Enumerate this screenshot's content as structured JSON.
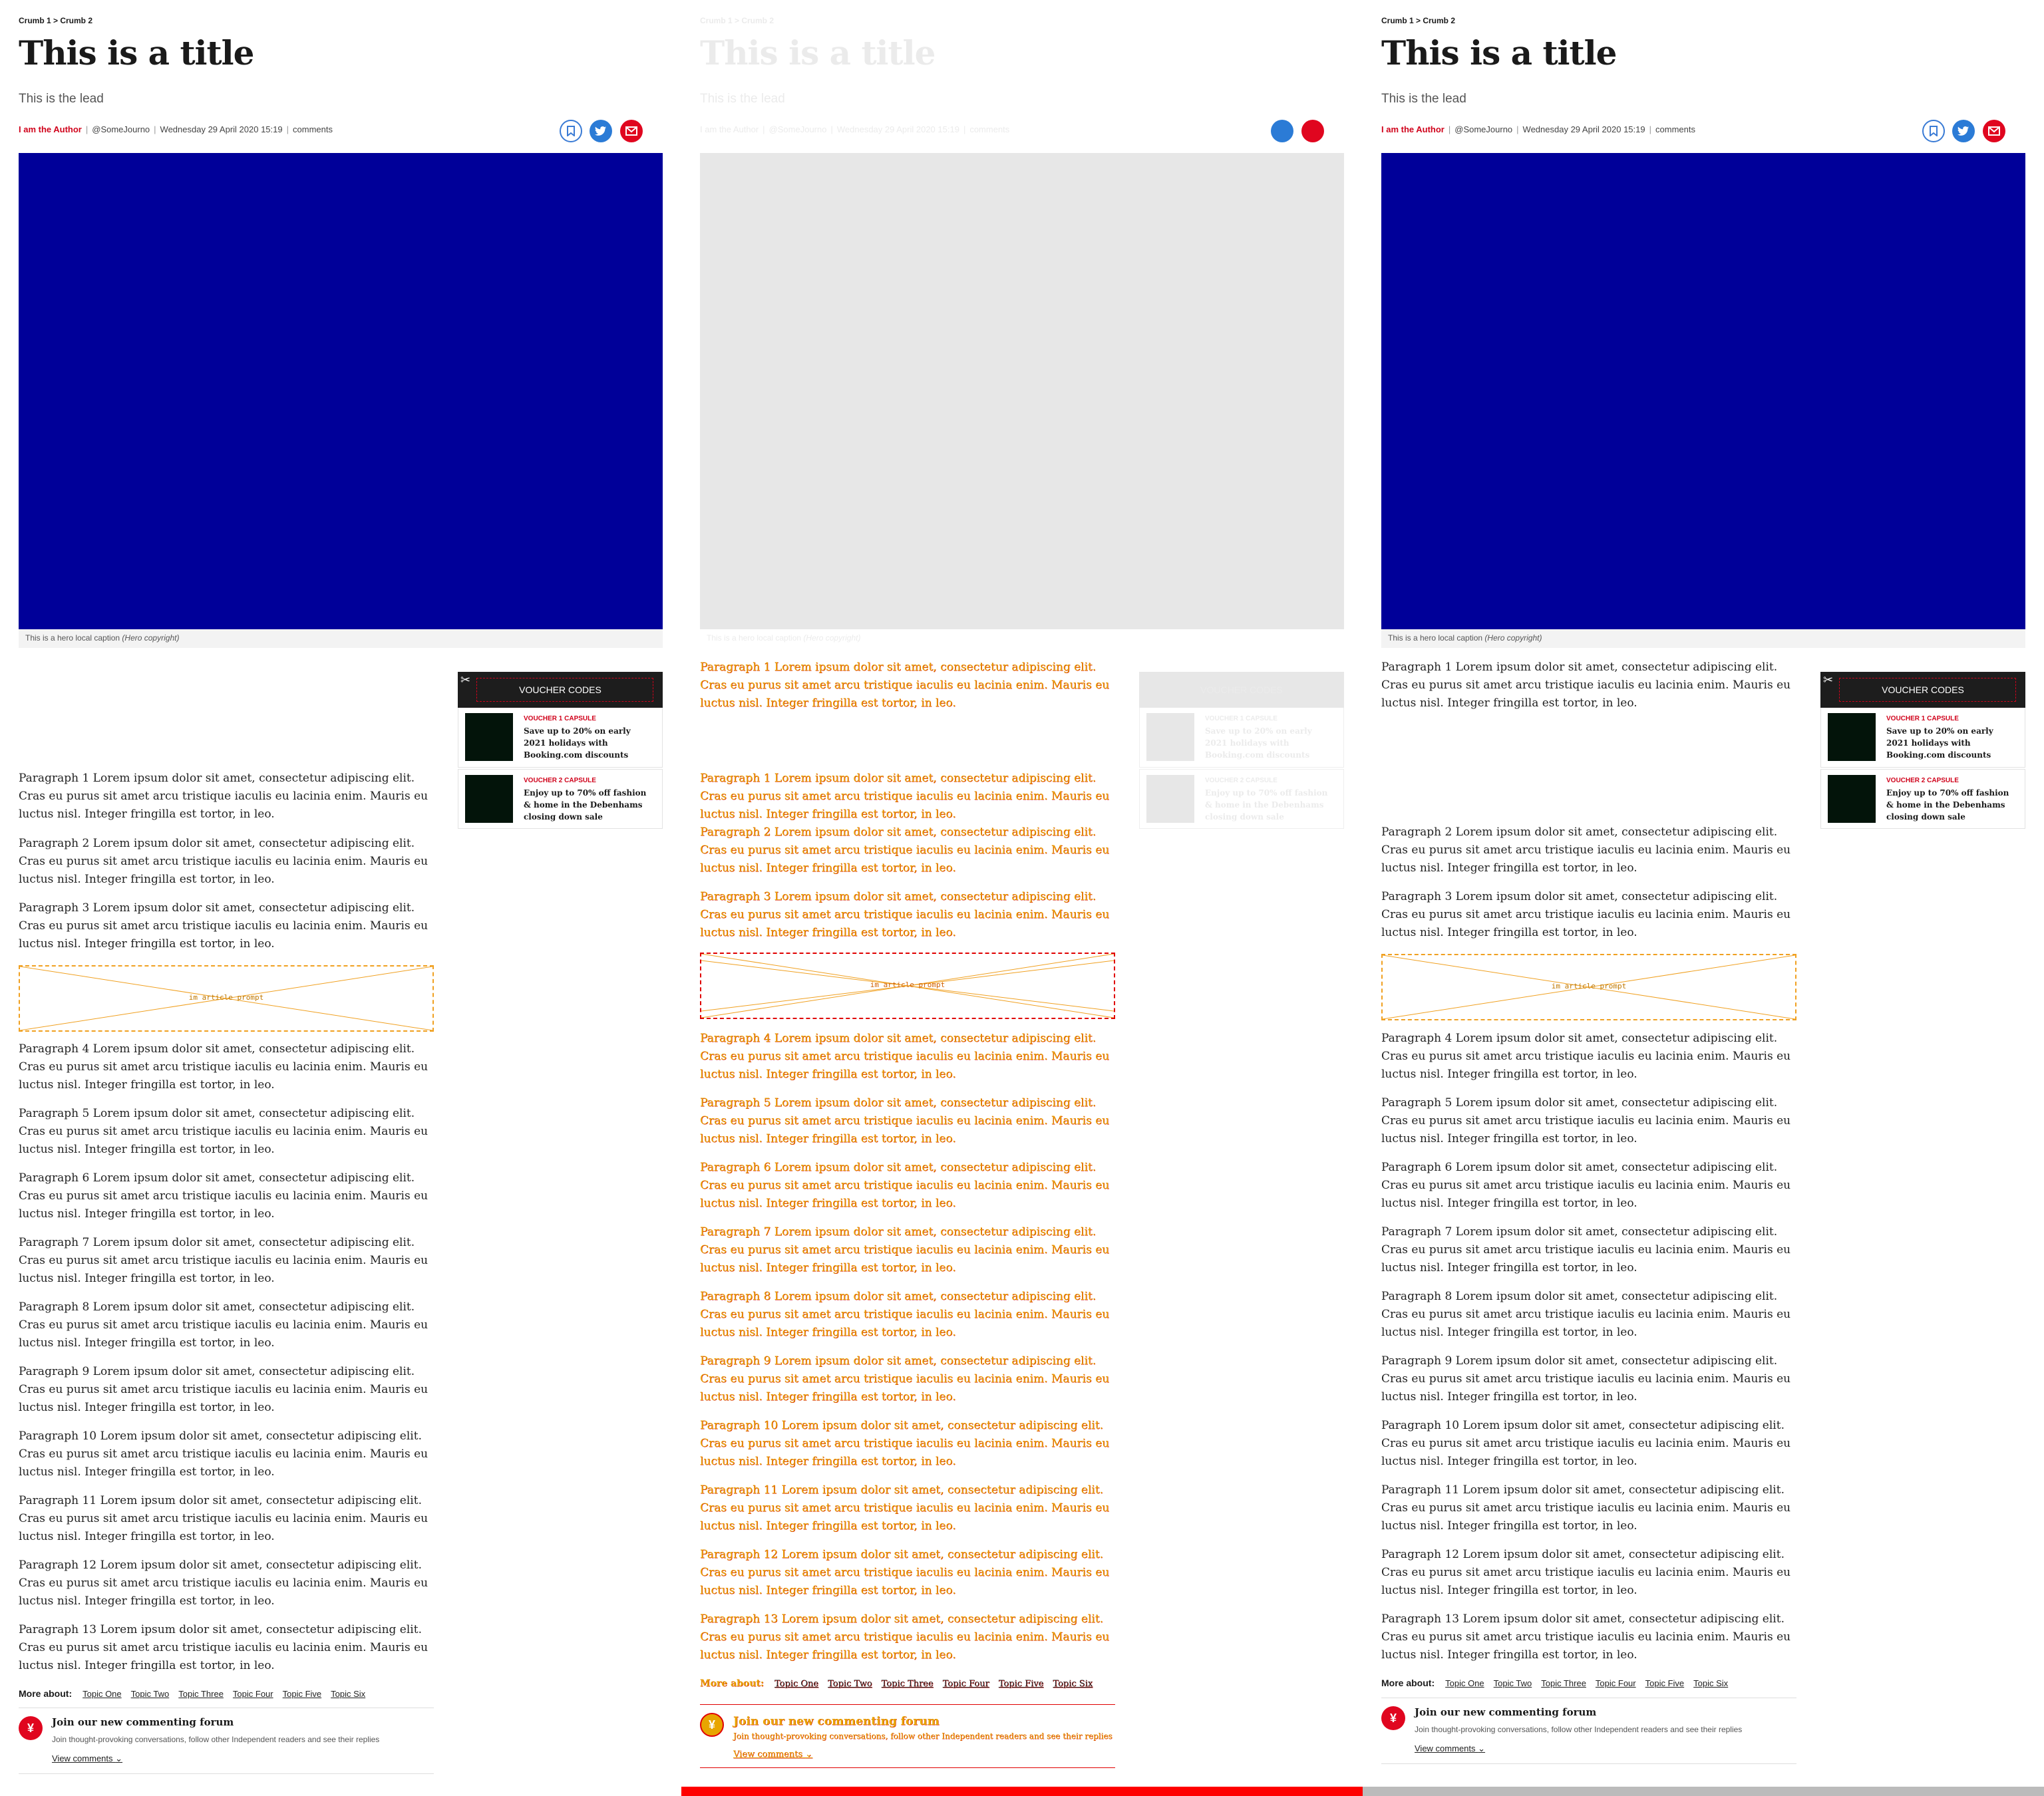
{
  "breadcrumb": "Crumb 1 > Crumb 2",
  "title": "This is a title",
  "lead": "This is the lead",
  "byline": {
    "author": "I am the Author",
    "handle": "@SomeJourno",
    "date": "Wednesday 29 April 2020 15:19",
    "comments": "comments"
  },
  "hero": {
    "caption": "This is a hero local caption",
    "copyright": "(Hero copyright)",
    "color": "#000099"
  },
  "paragraphs": [
    "Paragraph 1 Lorem ipsum dolor sit amet, consectetur adipiscing elit. Cras eu purus sit amet arcu tristique iaculis eu lacinia enim. Mauris eu luctus nisl. Integer fringilla est tortor, in leo.",
    "Paragraph 2 Lorem ipsum dolor sit amet, consectetur adipiscing elit. Cras eu purus sit amet arcu tristique iaculis eu lacinia enim. Mauris eu luctus nisl. Integer fringilla est tortor, in leo.",
    "Paragraph 3 Lorem ipsum dolor sit amet, consectetur adipiscing elit. Cras eu purus sit amet arcu tristique iaculis eu lacinia enim. Mauris eu luctus nisl. Integer fringilla est tortor, in leo.",
    "Paragraph 4 Lorem ipsum dolor sit amet, consectetur adipiscing elit. Cras eu purus sit amet arcu tristique iaculis eu lacinia enim. Mauris eu luctus nisl. Integer fringilla est tortor, in leo.",
    "Paragraph 5 Lorem ipsum dolor sit amet, consectetur adipiscing elit. Cras eu purus sit amet arcu tristique iaculis eu lacinia enim. Mauris eu luctus nisl. Integer fringilla est tortor, in leo.",
    "Paragraph 6 Lorem ipsum dolor sit amet, consectetur adipiscing elit. Cras eu purus sit amet arcu tristique iaculis eu lacinia enim. Mauris eu luctus nisl. Integer fringilla est tortor, in leo.",
    "Paragraph 7 Lorem ipsum dolor sit amet, consectetur adipiscing elit. Cras eu purus sit amet arcu tristique iaculis eu lacinia enim. Mauris eu luctus nisl. Integer fringilla est tortor, in leo.",
    "Paragraph 8 Lorem ipsum dolor sit amet, consectetur adipiscing elit. Cras eu purus sit amet arcu tristique iaculis eu lacinia enim. Mauris eu luctus nisl. Integer fringilla est tortor, in leo.",
    "Paragraph 9 Lorem ipsum dolor sit amet, consectetur adipiscing elit. Cras eu purus sit amet arcu tristique iaculis eu lacinia enim. Mauris eu luctus nisl. Integer fringilla est tortor, in leo.",
    "Paragraph 10 Lorem ipsum dolor sit amet, consectetur adipiscing elit. Cras eu purus sit amet arcu tristique iaculis eu lacinia enim. Mauris eu luctus nisl. Integer fringilla est tortor, in leo.",
    "Paragraph 11 Lorem ipsum dolor sit amet, consectetur adipiscing elit. Cras eu purus sit amet arcu tristique iaculis eu lacinia enim. Mauris eu luctus nisl. Integer fringilla est tortor, in leo.",
    "Paragraph 12 Lorem ipsum dolor sit amet, consectetur adipiscing elit. Cras eu purus sit amet arcu tristique iaculis eu lacinia enim. Mauris eu luctus nisl. Integer fringilla est tortor, in leo.",
    "Paragraph 13 Lorem ipsum dolor sit amet, consectetur adipiscing elit. Cras eu purus sit amet arcu tristique iaculis eu lacinia enim. Mauris eu luctus nisl. Integer fringilla est tortor, in leo."
  ],
  "prompt_label": "im article prompt",
  "voucher": {
    "heading": "VOUCHER CODES",
    "items": [
      {
        "capsule": "VOUCHER 1 CAPSULE",
        "text": "Save up to 20% on early 2021 holidays with Booking.com discounts"
      },
      {
        "capsule": "VOUCHER 2 CAPSULE",
        "text": "Enjoy up to 70% off fashion & home in the Debenhams closing down sale"
      }
    ]
  },
  "more_about": {
    "label": "More about:",
    "topics": [
      "Topic One",
      "Topic Two",
      "Topic Three",
      "Topic Four",
      "Topic Five",
      "Topic Six"
    ]
  },
  "forum": {
    "title": "Join our new commenting forum",
    "description": "Join thought-provoking conversations, follow other Independent readers and see their replies",
    "link": "View comments"
  },
  "icons": {
    "save": "bookmark-icon",
    "twitter": "twitter-icon",
    "email": "email-icon",
    "scissors": "scissors-icon",
    "forum_logo": "independent-eagle-icon",
    "chevron": "chevron-down-icon"
  },
  "colors": {
    "accent_red": "#d0021b",
    "twitter_blue": "#2b7bd6",
    "debug_text": "#e8a500",
    "debug_outline": "#e00000",
    "progress_active": "#ff0000",
    "progress_idle": "#bbbbbb"
  }
}
